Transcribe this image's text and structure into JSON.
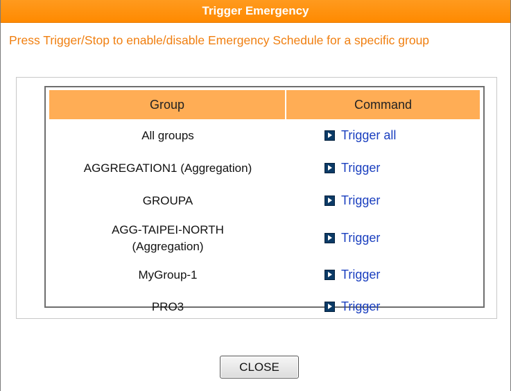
{
  "dialog": {
    "title": "Trigger Emergency",
    "description": "Press Trigger/Stop to enable/disable Emergency Schedule for a specific group",
    "close_label": "CLOSE"
  },
  "table": {
    "headers": {
      "group": "Group",
      "command": "Command"
    },
    "rows": [
      {
        "group": "All groups",
        "command": "Trigger all"
      },
      {
        "group": "AGGREGATION1 (Aggregation)",
        "command": "Trigger"
      },
      {
        "group": "GROUPA",
        "command": "Trigger"
      },
      {
        "group": "AGG-TAIPEI-NORTH (Aggregation)",
        "command": "Trigger"
      },
      {
        "group": "MyGroup-1",
        "command": "Trigger"
      },
      {
        "group": "PRO3",
        "command": "Trigger"
      }
    ]
  },
  "colors": {
    "title_bar": "#ff8c00",
    "description_text": "#f07f10",
    "table_header": "#ffad55",
    "link": "#1a3fbf",
    "icon": "#0b3a66"
  },
  "icons": {
    "command": "play-arrow-icon"
  }
}
